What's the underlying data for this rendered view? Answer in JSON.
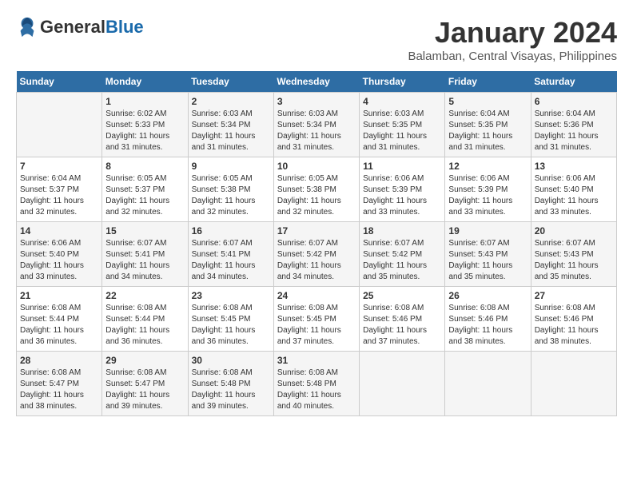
{
  "header": {
    "logo_general": "General",
    "logo_blue": "Blue",
    "month_title": "January 2024",
    "location": "Balamban, Central Visayas, Philippines"
  },
  "weekdays": [
    "Sunday",
    "Monday",
    "Tuesday",
    "Wednesday",
    "Thursday",
    "Friday",
    "Saturday"
  ],
  "weeks": [
    [
      {
        "day": "",
        "sunrise": "",
        "sunset": "",
        "daylight": ""
      },
      {
        "day": "1",
        "sunrise": "Sunrise: 6:02 AM",
        "sunset": "Sunset: 5:33 PM",
        "daylight": "Daylight: 11 hours and 31 minutes."
      },
      {
        "day": "2",
        "sunrise": "Sunrise: 6:03 AM",
        "sunset": "Sunset: 5:34 PM",
        "daylight": "Daylight: 11 hours and 31 minutes."
      },
      {
        "day": "3",
        "sunrise": "Sunrise: 6:03 AM",
        "sunset": "Sunset: 5:34 PM",
        "daylight": "Daylight: 11 hours and 31 minutes."
      },
      {
        "day": "4",
        "sunrise": "Sunrise: 6:03 AM",
        "sunset": "Sunset: 5:35 PM",
        "daylight": "Daylight: 11 hours and 31 minutes."
      },
      {
        "day": "5",
        "sunrise": "Sunrise: 6:04 AM",
        "sunset": "Sunset: 5:35 PM",
        "daylight": "Daylight: 11 hours and 31 minutes."
      },
      {
        "day": "6",
        "sunrise": "Sunrise: 6:04 AM",
        "sunset": "Sunset: 5:36 PM",
        "daylight": "Daylight: 11 hours and 31 minutes."
      }
    ],
    [
      {
        "day": "7",
        "sunrise": "Sunrise: 6:04 AM",
        "sunset": "Sunset: 5:37 PM",
        "daylight": "Daylight: 11 hours and 32 minutes."
      },
      {
        "day": "8",
        "sunrise": "Sunrise: 6:05 AM",
        "sunset": "Sunset: 5:37 PM",
        "daylight": "Daylight: 11 hours and 32 minutes."
      },
      {
        "day": "9",
        "sunrise": "Sunrise: 6:05 AM",
        "sunset": "Sunset: 5:38 PM",
        "daylight": "Daylight: 11 hours and 32 minutes."
      },
      {
        "day": "10",
        "sunrise": "Sunrise: 6:05 AM",
        "sunset": "Sunset: 5:38 PM",
        "daylight": "Daylight: 11 hours and 32 minutes."
      },
      {
        "day": "11",
        "sunrise": "Sunrise: 6:06 AM",
        "sunset": "Sunset: 5:39 PM",
        "daylight": "Daylight: 11 hours and 33 minutes."
      },
      {
        "day": "12",
        "sunrise": "Sunrise: 6:06 AM",
        "sunset": "Sunset: 5:39 PM",
        "daylight": "Daylight: 11 hours and 33 minutes."
      },
      {
        "day": "13",
        "sunrise": "Sunrise: 6:06 AM",
        "sunset": "Sunset: 5:40 PM",
        "daylight": "Daylight: 11 hours and 33 minutes."
      }
    ],
    [
      {
        "day": "14",
        "sunrise": "Sunrise: 6:06 AM",
        "sunset": "Sunset: 5:40 PM",
        "daylight": "Daylight: 11 hours and 33 minutes."
      },
      {
        "day": "15",
        "sunrise": "Sunrise: 6:07 AM",
        "sunset": "Sunset: 5:41 PM",
        "daylight": "Daylight: 11 hours and 34 minutes."
      },
      {
        "day": "16",
        "sunrise": "Sunrise: 6:07 AM",
        "sunset": "Sunset: 5:41 PM",
        "daylight": "Daylight: 11 hours and 34 minutes."
      },
      {
        "day": "17",
        "sunrise": "Sunrise: 6:07 AM",
        "sunset": "Sunset: 5:42 PM",
        "daylight": "Daylight: 11 hours and 34 minutes."
      },
      {
        "day": "18",
        "sunrise": "Sunrise: 6:07 AM",
        "sunset": "Sunset: 5:42 PM",
        "daylight": "Daylight: 11 hours and 35 minutes."
      },
      {
        "day": "19",
        "sunrise": "Sunrise: 6:07 AM",
        "sunset": "Sunset: 5:43 PM",
        "daylight": "Daylight: 11 hours and 35 minutes."
      },
      {
        "day": "20",
        "sunrise": "Sunrise: 6:07 AM",
        "sunset": "Sunset: 5:43 PM",
        "daylight": "Daylight: 11 hours and 35 minutes."
      }
    ],
    [
      {
        "day": "21",
        "sunrise": "Sunrise: 6:08 AM",
        "sunset": "Sunset: 5:44 PM",
        "daylight": "Daylight: 11 hours and 36 minutes."
      },
      {
        "day": "22",
        "sunrise": "Sunrise: 6:08 AM",
        "sunset": "Sunset: 5:44 PM",
        "daylight": "Daylight: 11 hours and 36 minutes."
      },
      {
        "day": "23",
        "sunrise": "Sunrise: 6:08 AM",
        "sunset": "Sunset: 5:45 PM",
        "daylight": "Daylight: 11 hours and 36 minutes."
      },
      {
        "day": "24",
        "sunrise": "Sunrise: 6:08 AM",
        "sunset": "Sunset: 5:45 PM",
        "daylight": "Daylight: 11 hours and 37 minutes."
      },
      {
        "day": "25",
        "sunrise": "Sunrise: 6:08 AM",
        "sunset": "Sunset: 5:46 PM",
        "daylight": "Daylight: 11 hours and 37 minutes."
      },
      {
        "day": "26",
        "sunrise": "Sunrise: 6:08 AM",
        "sunset": "Sunset: 5:46 PM",
        "daylight": "Daylight: 11 hours and 38 minutes."
      },
      {
        "day": "27",
        "sunrise": "Sunrise: 6:08 AM",
        "sunset": "Sunset: 5:46 PM",
        "daylight": "Daylight: 11 hours and 38 minutes."
      }
    ],
    [
      {
        "day": "28",
        "sunrise": "Sunrise: 6:08 AM",
        "sunset": "Sunset: 5:47 PM",
        "daylight": "Daylight: 11 hours and 38 minutes."
      },
      {
        "day": "29",
        "sunrise": "Sunrise: 6:08 AM",
        "sunset": "Sunset: 5:47 PM",
        "daylight": "Daylight: 11 hours and 39 minutes."
      },
      {
        "day": "30",
        "sunrise": "Sunrise: 6:08 AM",
        "sunset": "Sunset: 5:48 PM",
        "daylight": "Daylight: 11 hours and 39 minutes."
      },
      {
        "day": "31",
        "sunrise": "Sunrise: 6:08 AM",
        "sunset": "Sunset: 5:48 PM",
        "daylight": "Daylight: 11 hours and 40 minutes."
      },
      {
        "day": "",
        "sunrise": "",
        "sunset": "",
        "daylight": ""
      },
      {
        "day": "",
        "sunrise": "",
        "sunset": "",
        "daylight": ""
      },
      {
        "day": "",
        "sunrise": "",
        "sunset": "",
        "daylight": ""
      }
    ]
  ]
}
